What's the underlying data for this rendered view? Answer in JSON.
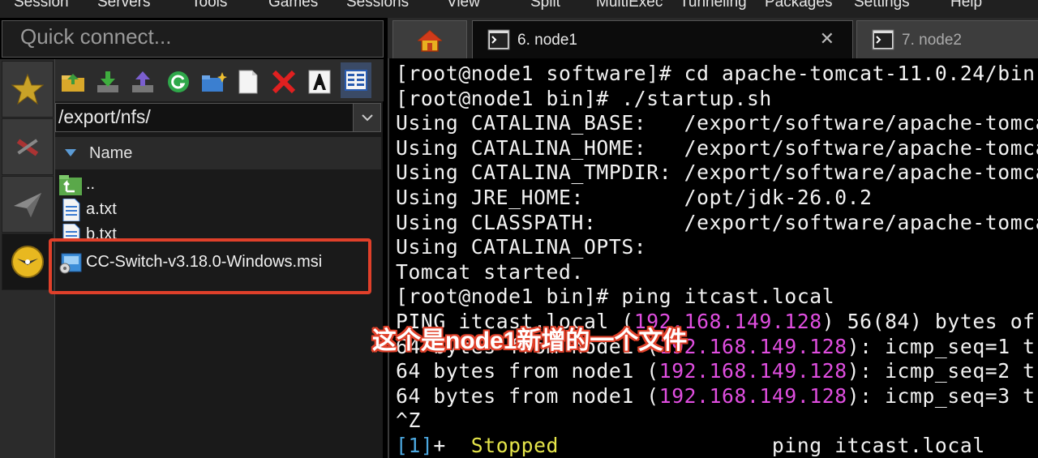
{
  "menu": [
    "Session",
    "Servers",
    "Tools",
    "Games",
    "Sessions",
    "View",
    "Split",
    "MultiExec",
    "Tunneling",
    "Packages",
    "Settings",
    "Help"
  ],
  "quick_connect": {
    "placeholder": "Quick connect..."
  },
  "side_tabs": [
    "star-icon",
    "tools-icon",
    "paper-plane-icon",
    "sftp-icon"
  ],
  "sftp": {
    "toolbar": [
      "folder-up-icon",
      "download-icon",
      "upload-icon",
      "refresh-icon",
      "new-folder-icon",
      "new-file-icon",
      "delete-icon",
      "rename-icon",
      "view-icon"
    ],
    "path": "/export/nfs/",
    "column_header": "Name",
    "files": [
      {
        "name": "..",
        "icon": "parent-folder-icon"
      },
      {
        "name": "a.txt",
        "icon": "text-file-icon"
      },
      {
        "name": "b.txt",
        "icon": "text-file-icon"
      },
      {
        "name": "CC-Switch-v3.18.0-Windows.msi",
        "icon": "msi-file-icon"
      }
    ]
  },
  "tabs": [
    {
      "label": "",
      "icon": "home-icon"
    },
    {
      "label": "6. node1",
      "icon": "terminal-icon",
      "active": true
    },
    {
      "label": "7. node2",
      "icon": "terminal-icon"
    }
  ],
  "terminal": {
    "lines": [
      [
        {
          "t": "[root@node1 software]# cd apache-tomcat-11.0.24/bin"
        }
      ],
      [
        {
          "t": "[root@node1 bin]# ./startup.sh"
        }
      ],
      [
        {
          "t": "Using CATALINA_BASE:   /export/software/apache-tomcat"
        }
      ],
      [
        {
          "t": "Using CATALINA_HOME:   /export/software/apache-tomcat"
        }
      ],
      [
        {
          "t": "Using CATALINA_TMPDIR: /export/software/apache-tomcat"
        }
      ],
      [
        {
          "t": "Using JRE_HOME:        /opt/jdk-26.0.2"
        }
      ],
      [
        {
          "t": "Using CLASSPATH:       /export/software/apache-tomcat"
        }
      ],
      [
        {
          "t": "Using CATALINA_OPTS:"
        }
      ],
      [
        {
          "t": "Tomcat started."
        }
      ],
      [
        {
          "t": "[root@node1 bin]# ping itcast.local"
        }
      ],
      [
        {
          "t": "PING itcast.local ("
        },
        {
          "t": "192.168.149.128",
          "c": "ip"
        },
        {
          "t": ") 56(84) bytes of"
        }
      ],
      [
        {
          "t": "64 bytes from node1 ("
        },
        {
          "t": "192.168.149.128",
          "c": "ip"
        },
        {
          "t": "): icmp_seq=1 t"
        }
      ],
      [
        {
          "t": "64 bytes from node1 ("
        },
        {
          "t": "192.168.149.128",
          "c": "ip"
        },
        {
          "t": "): icmp_seq=2 t"
        }
      ],
      [
        {
          "t": "64 bytes from node1 ("
        },
        {
          "t": "192.168.149.128",
          "c": "ip"
        },
        {
          "t": "): icmp_seq=3 t"
        }
      ],
      [
        {
          "t": "^Z"
        }
      ],
      [
        {
          "t": "[1]",
          "c": "blu"
        },
        {
          "t": "+  "
        },
        {
          "t": "Stopped",
          "c": "yel"
        },
        {
          "t": "                 ping itcast.local"
        }
      ]
    ]
  },
  "annotation": "这个是node1新增的一个文件",
  "colors": {
    "highlight": "#e0402a",
    "ip": "#e04ee0",
    "job": "#4ca8e0",
    "stopped": "#e6e64a"
  }
}
